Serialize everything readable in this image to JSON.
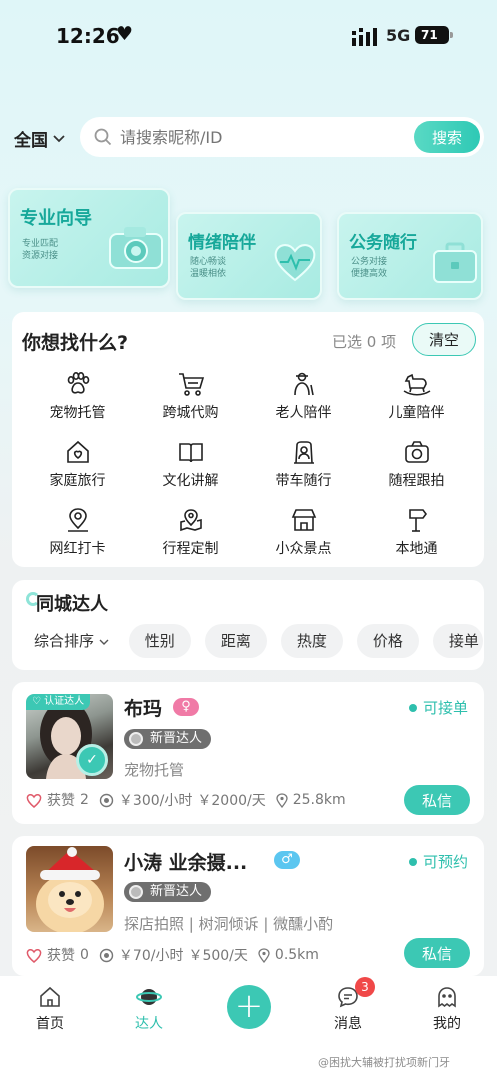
{
  "status_bar": {
    "time": "12:26",
    "network": "5G",
    "battery": "71"
  },
  "search": {
    "region": "全国",
    "placeholder": "请搜索昵称/ID",
    "button": "搜索"
  },
  "categories": [
    {
      "title": "专业向导",
      "sub1": "专业匹配",
      "sub2": "资源对接"
    },
    {
      "title": "情绪陪伴",
      "sub1": "随心畅谈",
      "sub2": "温暖相依"
    },
    {
      "title": "公务随行",
      "sub1": "公务对接",
      "sub2": "便捷高效"
    }
  ],
  "services": {
    "title": "你想找什么?",
    "selected_prefix": "已选",
    "selected_count": "0",
    "selected_suffix": "项",
    "clear": "清空",
    "items": [
      "宠物托管",
      "跨城代购",
      "老人陪伴",
      "儿童陪伴",
      "家庭旅行",
      "文化讲解",
      "带车随行",
      "随程跟拍",
      "网红打卡",
      "行程定制",
      "小众景点",
      "本地通"
    ]
  },
  "local": {
    "title": "同城达人",
    "filters": [
      "综合排序",
      "性别",
      "距离",
      "热度",
      "价格",
      "接单"
    ]
  },
  "talents": [
    {
      "name": "布玛",
      "gender": "♀",
      "gender_color": "#f07aa6",
      "verified": "认证达人",
      "tag": "新晋达人",
      "status": "可接单",
      "services": "宠物托管",
      "likes_label": "获赞",
      "likes": "2",
      "price_hour": "￥300/小时",
      "price_day": "￥2000/天",
      "distance": "25.8km",
      "action": "私信"
    },
    {
      "name": "小涛 业余摄...",
      "gender": "♂",
      "gender_color": "#5bc6f0",
      "tag": "新晋达人",
      "status": "可预约",
      "services": "探店拍照 | 树洞倾诉 | 微醺小酌",
      "likes_label": "获赞",
      "likes": "0",
      "price_hour": "￥70/小时",
      "price_day": "￥500/天",
      "distance": "0.5km",
      "action": "私信"
    }
  ],
  "tabbar": {
    "items": [
      "首页",
      "达人",
      "",
      "消息",
      "我的"
    ],
    "active": "达人",
    "message_badge": "3"
  },
  "watermark": "@困扰大辅被打扰项新门牙",
  "colors": {
    "accent": "#3cc8b4",
    "female": "#f07aa6",
    "male": "#5bc6f0"
  }
}
